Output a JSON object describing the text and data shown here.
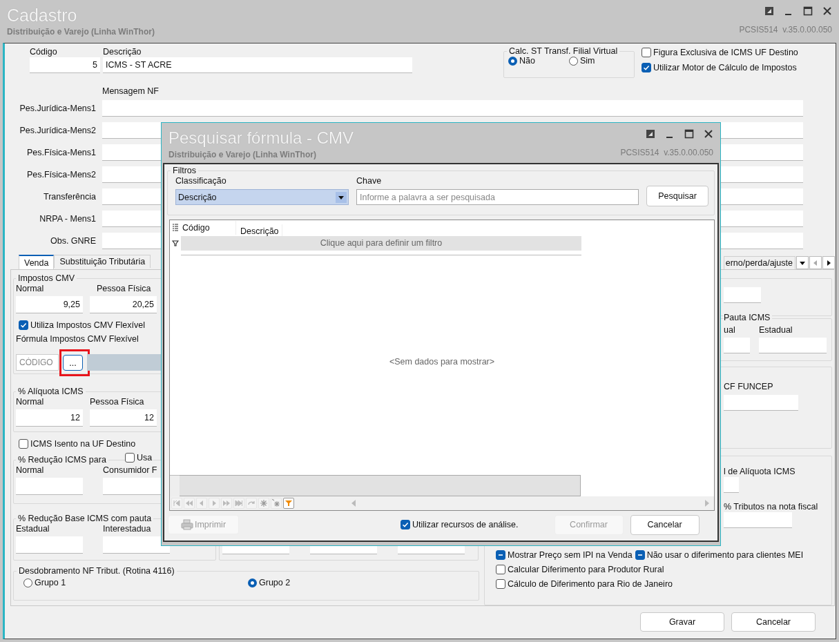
{
  "window": {
    "title": "Cadastro",
    "subtitle": "Distribuição e Varejo (Linha WinThor)",
    "version": "PCSIS514  v.35.0.00.050"
  },
  "header": {
    "codigo": {
      "label": "Código",
      "value": "5"
    },
    "descricao": {
      "label": "Descrição",
      "value": "ICMS - ST ACRE"
    },
    "calc_st": {
      "title": "Calc. ST Transf. Filial Virtual",
      "options": [
        {
          "label": "Não",
          "selected": true
        },
        {
          "label": "Sim",
          "selected": false
        }
      ]
    },
    "checkboxes": [
      {
        "label": "Figura Exclusiva de ICMS UF Destino",
        "checked": false
      },
      {
        "label": "Utilizar Motor de Cálculo de Impostos",
        "checked": true
      }
    ]
  },
  "mensagem_nf": {
    "title": "Mensagem NF",
    "rows": [
      {
        "label": "Pes.Jurídica-Mens1"
      },
      {
        "label": "Pes.Jurídica-Mens2"
      },
      {
        "label": "Pes.Física-Mens1"
      },
      {
        "label": "Pes.Física-Mens2"
      },
      {
        "label": "Transferência"
      },
      {
        "label": "NRPA - Mens1"
      },
      {
        "label": "Obs. GNRE"
      }
    ]
  },
  "tabs": [
    {
      "label": "Venda",
      "selected": true
    },
    {
      "label": "Substituição Tributária",
      "selected": false
    }
  ],
  "tab_fragment": {
    "label": "erno/perda/ajuste",
    "selected": false
  },
  "venda": {
    "impostos_cmv": {
      "title": "Impostos CMV",
      "fields": [
        {
          "label": "Normal",
          "value": "9,25"
        },
        {
          "label": "Pessoa Física",
          "value": "20,25"
        }
      ],
      "flexivel": {
        "label": "Utiliza Impostos CMV Flexível",
        "checked": true
      },
      "formula": {
        "label": "Fórmula Impostos CMV Flexível",
        "placeholder": "CÓDIGO",
        "button": "..."
      }
    },
    "aliquota_icms": {
      "title": "% Alíquota ICMS",
      "fields": [
        {
          "label": "Normal",
          "value": "12"
        },
        {
          "label": "Pessoa Física",
          "value": "12"
        }
      ]
    },
    "icms_isento": {
      "label": "ICMS Isento na UF Destino",
      "checked": false
    },
    "reducao_icms": {
      "title": "% Redução ICMS para",
      "option": {
        "label": "Usa",
        "checked": false
      },
      "fields": [
        {
          "label": "Normal"
        },
        {
          "label": "Consumidor F"
        }
      ]
    },
    "reducao_base": {
      "title": "% Redução Base ICMS com pauta",
      "fields": [
        {
          "label": "Estadual"
        },
        {
          "label": "Interestadua"
        }
      ]
    },
    "desdobramento": {
      "title": "Desdobramento NF Tribut. (Rotina 4116)",
      "options": [
        {
          "label": "Grupo 1",
          "selected": false
        },
        {
          "label": "Grupo 2",
          "selected": true
        }
      ]
    },
    "pauta_icms": {
      "title": "Pauta ICMS",
      "fields": [
        {
          "label": "ual"
        },
        {
          "label": "Estadual"
        }
      ]
    },
    "funcep": {
      "label": "CF FUNCEP"
    },
    "aliquota": {
      "label": "l de Alíquota ICMS"
    },
    "tributos": {
      "label": "% Tributos na nota fiscal"
    },
    "checkbox_rows": [
      [
        {
          "label": "Mostrar Preço sem IPI na Venda",
          "indeterminate": true
        },
        {
          "label": "Não usar o diferimento para clientes MEI",
          "indeterminate": true
        }
      ],
      [
        {
          "label": "Calcular Diferimento para Produtor Rural",
          "indeterminate": false
        }
      ],
      [
        {
          "label": "Cálculo de Diferimento para Rio de Janeiro",
          "indeterminate": false
        }
      ]
    ]
  },
  "buttons": [
    "Gravar",
    "Cancelar"
  ],
  "dialog": {
    "title": "Pesquisar fórmula - CMV",
    "subtitle": "Distribuição e Varejo (Linha WinThor)",
    "version": "PCSIS514  v.35.0.00.050",
    "filters": {
      "title": "Filtros",
      "classificacao": {
        "label": "Classificação",
        "value": "Descrição"
      },
      "chave": {
        "label": "Chave",
        "placeholder": "Informe a palavra a ser pesquisada"
      },
      "button": "Pesquisar"
    },
    "grid": {
      "columns": [
        "Código",
        "Descrição"
      ],
      "filter_hint": "Clique aqui para definir um filtro",
      "empty": "<Sem dados para mostrar>"
    },
    "print_button": {
      "label": "Imprimir",
      "disabled": true
    },
    "analysis": {
      "label": "Utilizar recursos de análise.",
      "checked": true
    },
    "confirm_button": {
      "label": "Confirmar",
      "disabled": true
    },
    "cancel_button": {
      "label": "Cancelar",
      "disabled": false
    }
  }
}
